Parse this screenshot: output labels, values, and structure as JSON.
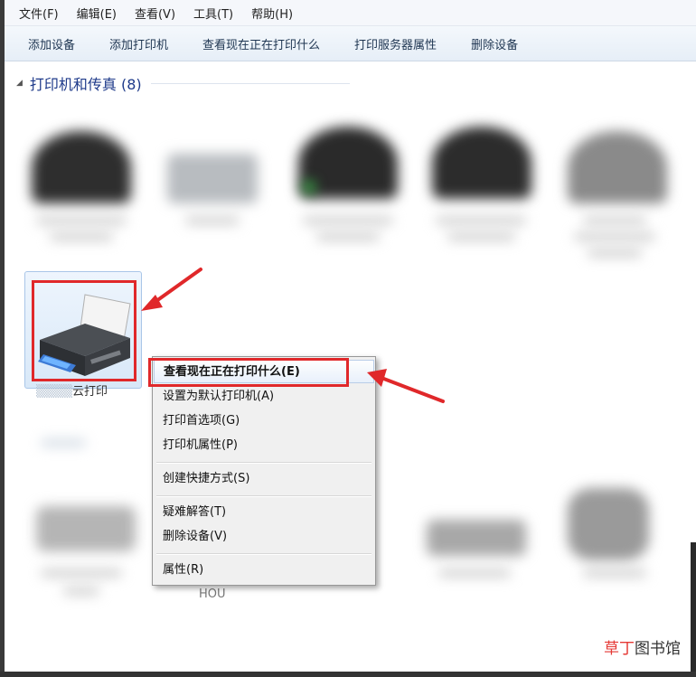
{
  "menubar": {
    "items": [
      "文件(F)",
      "编辑(E)",
      "查看(V)",
      "工具(T)",
      "帮助(H)"
    ]
  },
  "toolbar": {
    "add_device": "添加设备",
    "add_printer": "添加打印机",
    "see_printing": "查看现在正在打印什么",
    "server_props": "打印服务器属性",
    "remove_device": "删除设备"
  },
  "group": {
    "title": "打印机和传真 (8)"
  },
  "selected_device": {
    "label_partial": "云打印"
  },
  "bottom_device": {
    "label_partial": "HOU"
  },
  "context_menu": {
    "see_printing": "查看现在正在打印什么(E)",
    "set_default": "设置为默认打印机(A)",
    "preferences": "打印首选项(G)",
    "printer_props": "打印机属性(P)",
    "create_shortcut": "创建快捷方式(S)",
    "troubleshoot": "疑难解答(T)",
    "remove_device": "删除设备(V)",
    "properties": "属性(R)"
  },
  "watermark": {
    "part1": "草丁",
    "part2": "图书馆"
  },
  "colors": {
    "annotation_red": "#e0282a",
    "header_blue": "#1e3a8a"
  }
}
